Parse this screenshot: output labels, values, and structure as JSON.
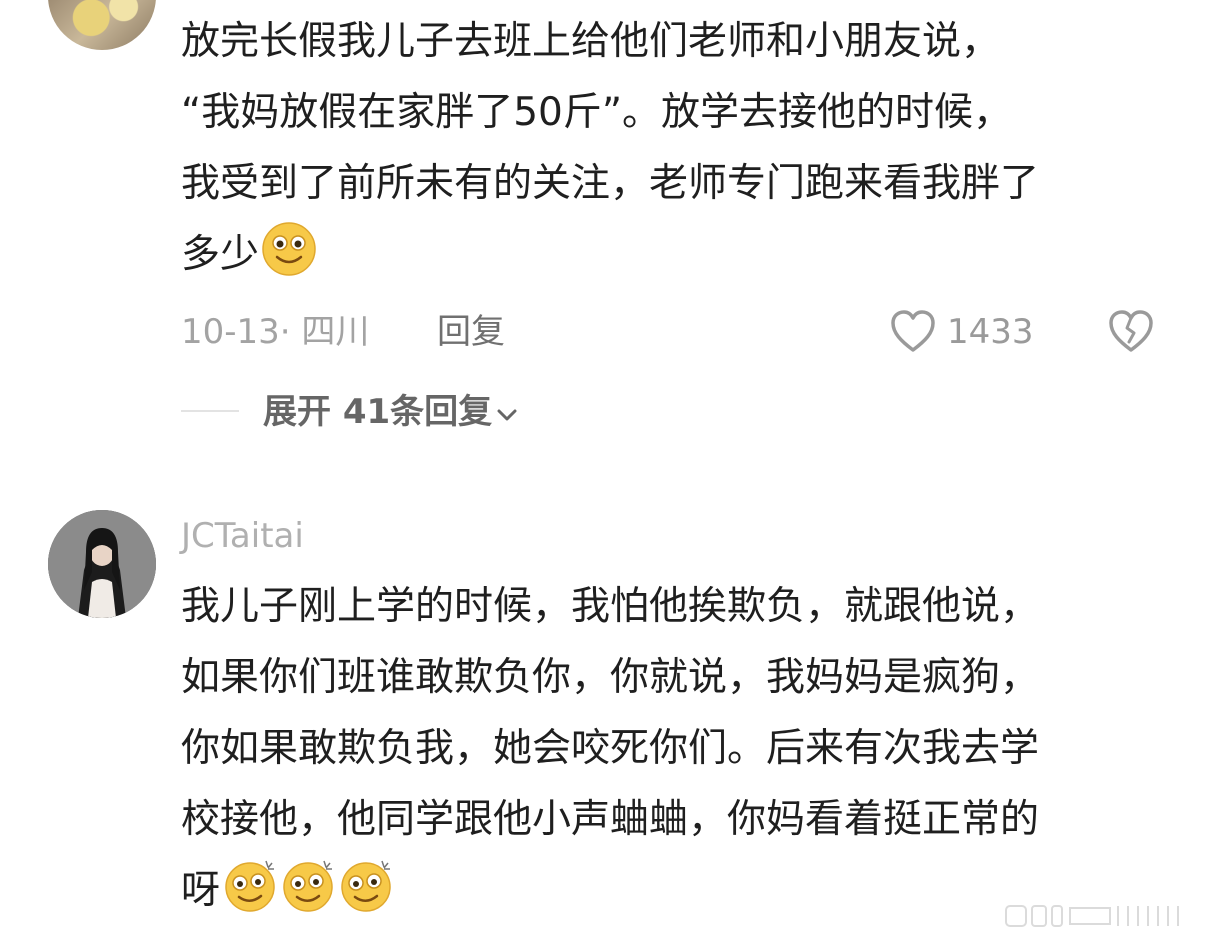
{
  "comment1": {
    "lines": [
      "放完长假我儿子去班上给他们老师和小朋友说，",
      "“我妈放假在家胖了50斤”。放学去接他的时候，",
      "我受到了前所未有的关注，老师专门跑来看我胖了",
      "多少"
    ],
    "emoji": "smile-emoji",
    "date_location": "10-13· 四川",
    "reply_label": "回复",
    "like_count": "1433",
    "expand_label": "展开 41条回复"
  },
  "comment2": {
    "username": "JCTaitai",
    "lines": [
      "我儿子刚上学的时候，我怕他挨欺负，就跟他说，",
      "如果你们班谁敢欺负你，你就说，我妈妈是疯狗，",
      "你如果敢欺负我，她会咬死你们。后来有次我去学",
      "校接他，他同学跟他小声蛐蛐，你妈看着挺正常的",
      "呀"
    ],
    "emoji": "dizzy-emoji"
  },
  "colors": {
    "text": "#1f1f1f",
    "meta": "#a3a3a3",
    "reply": "#707070",
    "emoji_face": "#f7c948"
  }
}
